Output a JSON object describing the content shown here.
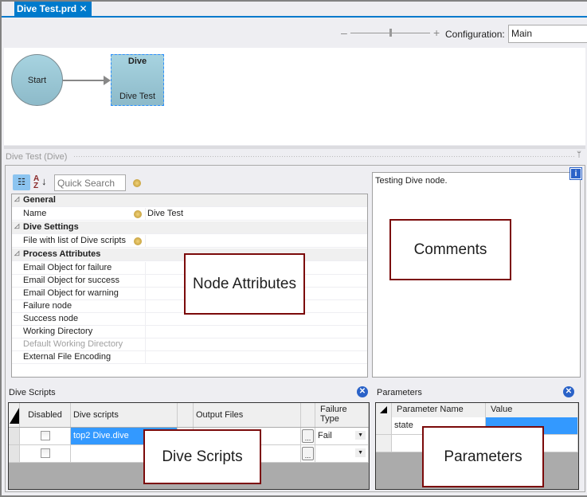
{
  "tab": {
    "title": "Dive Test.prd",
    "close_icon": "close-icon"
  },
  "toolbar": {
    "zoom_minus": "–",
    "zoom_plus": "+",
    "zoom_level": 50,
    "config_label": "Configuration:",
    "config_value": "Main"
  },
  "canvas": {
    "start_label": "Start",
    "dive_type": "Dive",
    "dive_name": "Dive Test"
  },
  "panel_title": "Dive Test (Dive)",
  "properties": {
    "search_placeholder": "Quick Search",
    "rows": [
      {
        "type": "cat",
        "label": "General"
      },
      {
        "type": "prop",
        "label": "Name",
        "value": "Dive Test",
        "coin": true
      },
      {
        "type": "cat",
        "label": "Dive Settings"
      },
      {
        "type": "prop",
        "label": "File with list of Dive scripts",
        "value": "",
        "coin": true
      },
      {
        "type": "cat",
        "label": "Process Attributes"
      },
      {
        "type": "prop",
        "label": "Email Object for failure",
        "value": ""
      },
      {
        "type": "prop",
        "label": "Email Object for success",
        "value": ""
      },
      {
        "type": "prop",
        "label": "Email Object for warning",
        "value": ""
      },
      {
        "type": "prop",
        "label": "Failure node",
        "value": ""
      },
      {
        "type": "prop",
        "label": "Success node",
        "value": ""
      },
      {
        "type": "prop",
        "label": "Working Directory",
        "value": ""
      },
      {
        "type": "prop",
        "label": "Default Working Directory",
        "value": "",
        "disabled": true
      },
      {
        "type": "prop",
        "label": "External File Encoding",
        "value": ""
      }
    ]
  },
  "comments": {
    "text": "Testing Dive node."
  },
  "annotations": {
    "node_attributes": "Node Attributes",
    "comments": "Comments",
    "dive_scripts": "Dive Scripts",
    "parameters": "Parameters"
  },
  "dive_scripts": {
    "title": "Dive Scripts",
    "columns": [
      "Disabled",
      "Dive scripts",
      "",
      "Output Files",
      "",
      "Failure Type"
    ],
    "rows": [
      {
        "disabled": false,
        "script": "top2 Dive.dive",
        "output": "",
        "btn": "...",
        "failure": "Fail"
      },
      {
        "disabled": false,
        "script": "",
        "output": "",
        "btn": "...",
        "failure": ""
      }
    ]
  },
  "parameters": {
    "title": "Parameters",
    "columns": [
      "Parameter Name",
      "Value"
    ],
    "rows": [
      {
        "name": "state",
        "value": ""
      }
    ]
  },
  "colors": {
    "accent": "#007acc",
    "selection": "#3399ff",
    "annotation_border": "#7b0a0a"
  }
}
